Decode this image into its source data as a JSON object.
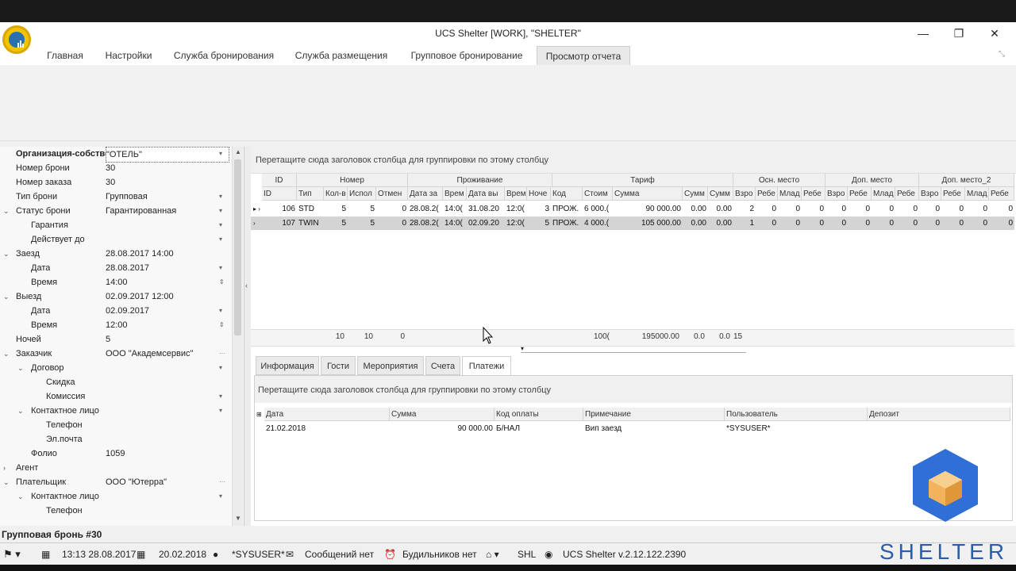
{
  "window": {
    "title": "UCS Shelter [WORK], \"SHELTER\"",
    "minimize": "—",
    "restore": "❐",
    "close": "✕"
  },
  "tabs": [
    "Главная",
    "Настройки",
    "Служба бронирования",
    "Служба размещения",
    "Групповое бронирование",
    "Просмотр отчета"
  ],
  "left_panel": {
    "rows": [
      {
        "label": "Организация-собстве",
        "value": "\"ОТЕЛЬ\"",
        "bold": true,
        "indent": 0
      },
      {
        "label": "Номер брони",
        "value": "30",
        "indent": 0
      },
      {
        "label": "Номер заказа",
        "value": "30",
        "indent": 0
      },
      {
        "label": "Тип брони",
        "value": "Групповая",
        "indent": 0
      },
      {
        "label": "Статус брони",
        "value": "Гарантированная",
        "indent": 0,
        "caret": "⌄"
      },
      {
        "label": "Гарантия",
        "value": "",
        "indent": 1
      },
      {
        "label": "Действует до",
        "value": "",
        "indent": 1
      },
      {
        "label": "Заезд",
        "value": "28.08.2017 14:00",
        "indent": 0,
        "caret": "⌄"
      },
      {
        "label": "Дата",
        "value": "28.08.2017",
        "indent": 1
      },
      {
        "label": "Время",
        "value": "14:00",
        "indent": 1
      },
      {
        "label": "Выезд",
        "value": "02.09.2017 12:00",
        "indent": 0,
        "caret": "⌄"
      },
      {
        "label": "Дата",
        "value": "02.09.2017",
        "indent": 1
      },
      {
        "label": "Время",
        "value": "12:00",
        "indent": 1
      },
      {
        "label": "Ночей",
        "value": "5",
        "indent": 0
      },
      {
        "label": "Заказчик",
        "value": "ООО \"Академсервис\"",
        "indent": 0,
        "caret": "⌄"
      },
      {
        "label": "Договор",
        "value": "",
        "indent": 1,
        "caret": "⌄"
      },
      {
        "label": "Скидка",
        "value": "",
        "indent": 2
      },
      {
        "label": "Комиссия",
        "value": "",
        "indent": 2
      },
      {
        "label": "Контактное лицо",
        "value": "",
        "indent": 1,
        "caret": "⌄"
      },
      {
        "label": "Телефон",
        "value": "",
        "indent": 2
      },
      {
        "label": "Эл.почта",
        "value": "",
        "indent": 2
      },
      {
        "label": "Фолио",
        "value": "1059",
        "indent": 1
      },
      {
        "label": "Агент",
        "value": "",
        "indent": 0,
        "caret": "›"
      },
      {
        "label": "Плательщик",
        "value": "ООО \"Ютерра\"",
        "indent": 0,
        "caret": "⌄"
      },
      {
        "label": "Контактное лицо",
        "value": "",
        "indent": 1,
        "caret": "⌄"
      },
      {
        "label": "Телефон",
        "value": "",
        "indent": 2
      }
    ],
    "footer_label": "Групповая бронь #30"
  },
  "main_grid": {
    "group_hint": "Перетащите сюда заголовок столбца для группировки по этому столбцу",
    "band_headers": [
      "ID",
      "Номер",
      "Проживание",
      "Тариф",
      "Осн. место",
      "Доп. место",
      "Доп. место_2"
    ],
    "columns": [
      "ID",
      "Тип",
      "Кол-в",
      "Испол",
      "Отмен",
      "Дата за",
      "Врем",
      "Дата вы",
      "Врем",
      "Ноче",
      "Код",
      "Стоим",
      "Сумма",
      "Сумм",
      "Сумм",
      "Взро",
      "Ребе",
      "Млад",
      "Ребе",
      "Взро",
      "Ребе",
      "Млад",
      "Ребе",
      "Взро",
      "Ребе",
      "Млад",
      "Ребе"
    ],
    "rows": [
      [
        "106",
        "STD",
        "5",
        "5",
        "0",
        "28.08.2(",
        "14:0(",
        "31.08.20",
        "12:0(",
        "3",
        "ПРОЖ.",
        "6 000.(",
        "90 000.00",
        "0.00",
        "0.00",
        "2",
        "0",
        "0",
        "0",
        "0",
        "0",
        "0",
        "0",
        "0",
        "0",
        "0",
        "0"
      ],
      [
        "107",
        "TWIN",
        "5",
        "5",
        "0",
        "28.08.2(",
        "14:0(",
        "02.09.20",
        "12:0(",
        "5",
        "ПРОЖ.",
        "4 000.(",
        "105 000.00",
        "0.00",
        "0.00",
        "1",
        "0",
        "0",
        "0",
        "0",
        "0",
        "0",
        "0",
        "0",
        "0",
        "0",
        "0"
      ]
    ],
    "totals": {
      "kol": "10",
      "ispol": "10",
      "otmen": "0",
      "stoim": "100(",
      "summa": "195000.00",
      "s1": "0.0",
      "s2": "0.0",
      "vzro": "15"
    }
  },
  "sub_tabs": [
    "Информация",
    "Гости",
    "Мероприятия",
    "Счета",
    "Платежи"
  ],
  "payments": {
    "group_hint": "Перетащите сюда заголовок столбца для группировки по этому столбцу",
    "columns": [
      "Дата",
      "Сумма",
      "Код оплаты",
      "Примечание",
      "Пользователь",
      "Депозит"
    ],
    "rows": [
      [
        "21.02.2018",
        "90 000.00",
        "Б/НАЛ",
        "Вип заезд",
        "*SYSUSER*",
        ""
      ]
    ]
  },
  "statusbar": {
    "datetime": "13:13 28.08.2017",
    "date": "20.02.2018",
    "user": "*SYSUSER*",
    "messages": "Сообщений нет",
    "alarms": "Будильников нет",
    "code": "SHL",
    "version": "UCS Shelter v.2.12.122.2390"
  },
  "brand": "SHELTER",
  "colors": {
    "accent": "#2a5ea8",
    "selected_row": "#d4d4d4"
  }
}
